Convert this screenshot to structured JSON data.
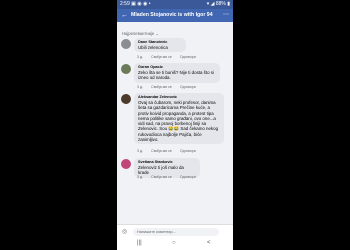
{
  "statusbar": {
    "left": "2:59 ▣ ◉ ◉ •",
    "right": "▾ ◢ 88% ▮"
  },
  "header": {
    "back": "←",
    "title": "Mladen Stojanovic is with Igor 94",
    "emoji": "❤ ◉ ◉",
    "more": "⋯"
  },
  "filter": "Најрелевантније ⌄",
  "comments": [
    {
      "name": "Dane Stanoievic",
      "text": "Ubili zelenorica",
      "time": "3 д.",
      "like": "Свиђа ми се",
      "reply": "Одговори",
      "avatar_color": "#8a8d91"
    },
    {
      "name": "Goran Opacic",
      "text": "Zeko šta se ti buniš? Nije ti dosta što si izneo od naroda.",
      "time": "3 д.",
      "like": "Свиђа ми се",
      "reply": "Одговори",
      "avatar_color": "#6b7b5a"
    },
    {
      "name": "Aleksandar Zelenovic",
      "text": "Ovaj sa ćubarom, neki profesor, danima šeta sa gazdaricama Prečine kuće, a protiv koivid propaganda, a protest tipa nema politike samo građani, ovo one...a vidi sad, na pravoj borbenoj liniji sa Zelenovic. Sou 😂😂 Sad čekamo nekog rukovodioca najbolje Pajića, biće zanimljivo.",
      "time": "3 д.",
      "like": "Свиђа ми се",
      "reply": "Одговори",
      "avatar_color": "#4a3a2a"
    },
    {
      "name": "Svetlana Stankovic",
      "text": "Zelenoviz ti još malo da krade",
      "time": "3 д.",
      "like": "Свиђа ми се",
      "reply": "Одговори",
      "avatar_color": "#c2457a"
    }
  ],
  "composer": {
    "placeholder": "Напишите коментар...",
    "camera": "◎"
  },
  "navbar": {
    "recent": "|||",
    "home": "○",
    "back": "<"
  }
}
